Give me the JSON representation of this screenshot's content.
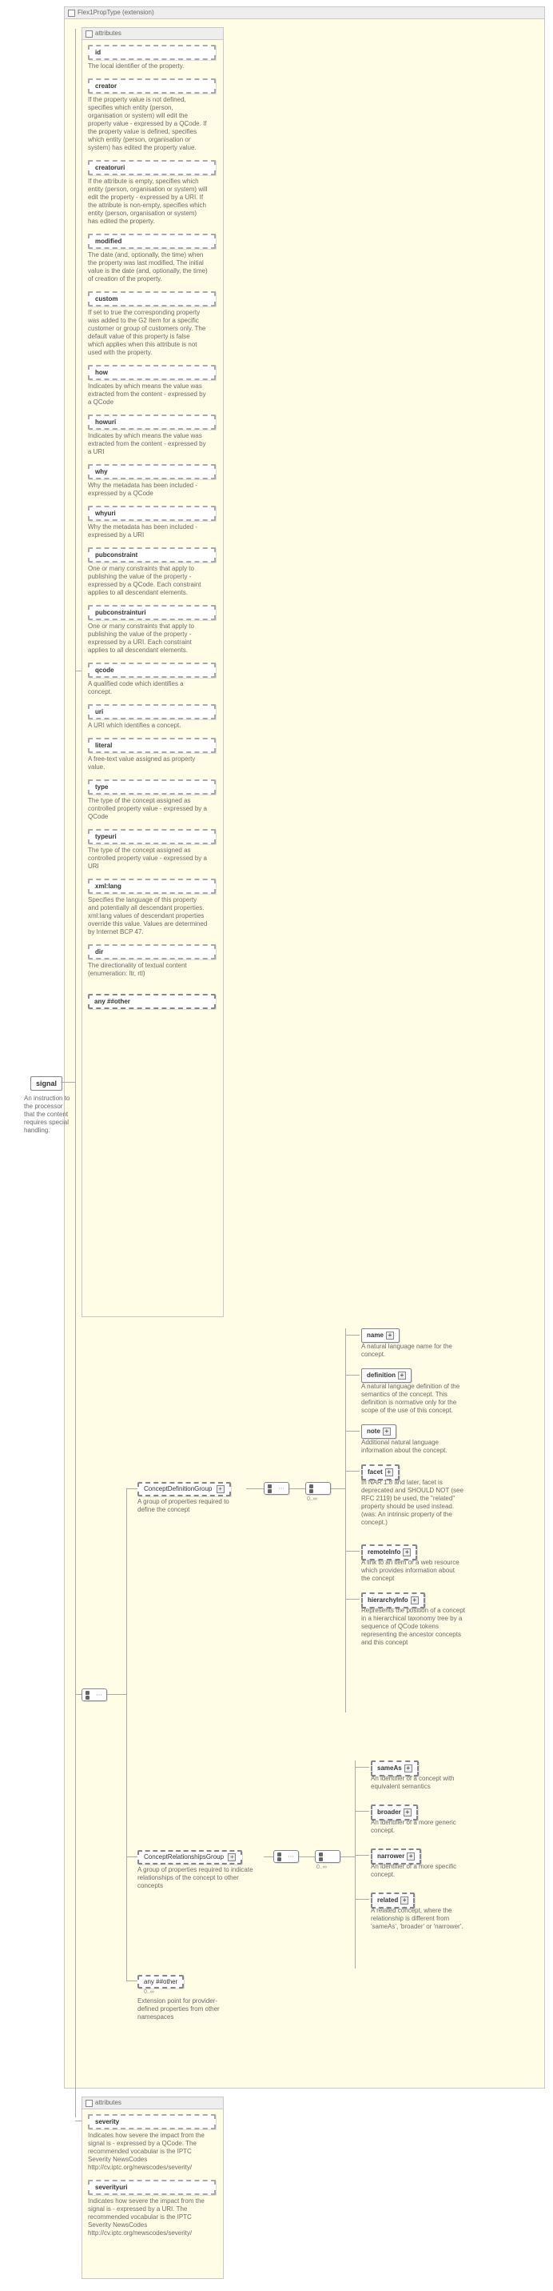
{
  "ext_title": "Flex1PropType (extension)",
  "root": {
    "label": "signal",
    "desc": "An instruction to the processor that the content requires special handling."
  },
  "attr_block_title": "attributes",
  "attrs1": [
    {
      "name": "id",
      "desc": "The local identifier of the property."
    },
    {
      "name": "creator",
      "desc": "If the property value is not defined, specifies which entity (person, organisation or system) will edit the property value - expressed by a QCode. If the property value is defined, specifies which entity (person, organisation or system) has edited the property value."
    },
    {
      "name": "creatoruri",
      "desc": "If the attribute is empty, specifies which entity (person, organisation or system) will edit the property - expressed by a URI. If the attribute is non-empty, specifies which entity (person, organisation or system) has edited the property."
    },
    {
      "name": "modified",
      "desc": "The date (and, optionally, the time) when the property was last modified. The initial value is the date (and, optionally, the time) of creation of the property."
    },
    {
      "name": "custom",
      "desc": "If set to true the corresponding property was added to the G2 Item for a specific customer or group of customers only. The default value of this property is false which applies when this attribute is not used with the property."
    },
    {
      "name": "how",
      "desc": "Indicates by which means the value was extracted from the content - expressed by a QCode"
    },
    {
      "name": "howuri",
      "desc": "Indicates by which means the value was extracted from the content - expressed by a URI"
    },
    {
      "name": "why",
      "desc": "Why the metadata has been included - expressed by a QCode"
    },
    {
      "name": "whyuri",
      "desc": "Why the metadata has been included - expressed by a URI"
    },
    {
      "name": "pubconstraint",
      "desc": "One or many constraints that apply to publishing the value of the property - expressed by a QCode. Each constraint applies to all descendant elements."
    },
    {
      "name": "pubconstrainturi",
      "desc": "One or many constraints that apply to publishing the value of the property - expressed by a URI. Each constraint applies to all descendant elements."
    },
    {
      "name": "qcode",
      "desc": "A qualified code which identifies a concept."
    },
    {
      "name": "uri",
      "desc": "A URI which identifies a concept."
    },
    {
      "name": "literal",
      "desc": "A free-text value assigned as property value."
    },
    {
      "name": "type",
      "desc": "The type of the concept assigned as controlled property value - expressed by a QCode"
    },
    {
      "name": "typeuri",
      "desc": "The type of the concept assigned as controlled property value - expressed by a URI"
    },
    {
      "name": "xml:lang",
      "desc": "Specifies the language of this property and potentially all descendant properties. xml:lang values of descendant properties override this value. Values are determined by Internet BCP 47."
    },
    {
      "name": "dir",
      "desc": "The directionality of textual content (enumeration: ltr, rtl)"
    }
  ],
  "any_other": "any ##other",
  "groups": {
    "def": {
      "label": "ConceptDefinitionGroup",
      "desc": "A group of properties required to define the concept",
      "plus": true
    },
    "rel": {
      "label": "ConceptRelationshipsGroup",
      "desc": "A group of properties required to indicate relationships of the concept to other concepts",
      "plus": true
    },
    "any": {
      "label": "any ##other",
      "desc": "Extension point for provider-defined properties from other namespaces"
    }
  },
  "def_children": [
    {
      "name": "name",
      "desc": "A natural language name for the concept.",
      "dashed": false
    },
    {
      "name": "definition",
      "desc": "A natural language definition of the semantics of the concept. This definition is normative only for the scope of the use of this concept.",
      "dashed": false
    },
    {
      "name": "note",
      "desc": "Additional natural language information about the concept.",
      "dashed": false
    },
    {
      "name": "facet",
      "desc": "In NAR 1.8 and later, facet is deprecated and SHOULD NOT (see RFC 2119) be used, the \"related\" property should be used instead. (was: An intrinsic property of the concept.)",
      "dashed": true
    },
    {
      "name": "remoteInfo",
      "desc": "A link to an item or a web resource which provides information about the concept",
      "dashed": true
    },
    {
      "name": "hierarchyInfo",
      "desc": "Represents the position of a concept in a hierarchical taxonomy tree by a sequence of QCode tokens representing the ancestor concepts and this concept",
      "dashed": true
    }
  ],
  "rel_children": [
    {
      "name": "sameAs",
      "desc": "An identifier of a concept with equivalent semantics",
      "dashed": true
    },
    {
      "name": "broader",
      "desc": "An identifier of a more generic concept.",
      "dashed": true
    },
    {
      "name": "narrower",
      "desc": "An identifier of a more specific concept.",
      "dashed": true
    },
    {
      "name": "related",
      "desc": "A related concept, where the relationship is different from 'sameAs', 'broader' or 'narrower'.",
      "dashed": true
    }
  ],
  "occ_0inf": "0..∞",
  "attrs2_title": "attributes",
  "attrs2": [
    {
      "name": "severity",
      "desc": "Indicates how severe the impact from the signal is - expressed by a QCode. The recommended vocabular is the IPTC Severity NewsCodes http://cv.iptc.org/newscodes/severity/"
    },
    {
      "name": "severityuri",
      "desc": "Indicates how severe the impact from the signal is - expressed by a URI. The recommended vocabular is the IPTC Severity NewsCodes http://cv.iptc.org/newscodes/severity/"
    }
  ]
}
